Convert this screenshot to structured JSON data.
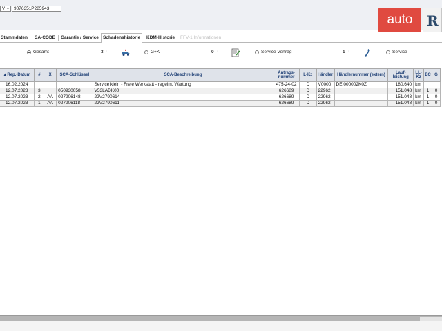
{
  "header": {
    "vin_select_value": "V",
    "vin_value": "9076351P285943",
    "logo_text": "auto",
    "logo2_text": "R"
  },
  "tabs": [
    {
      "label": "Stammdaten"
    },
    {
      "label": "SA-CODE"
    },
    {
      "label": "Garantie / Service"
    },
    {
      "label": "Schadenshistorie"
    },
    {
      "label": "KDM-Historie"
    },
    {
      "label": "FFV-1 Informationen"
    }
  ],
  "filters": {
    "gesamt_label": "Gesamt",
    "gk_count": "3",
    "gk_label": "G+K",
    "vertrag_count": "0",
    "vertrag_label": "Service Vertrag",
    "service_count": "1",
    "service_label": "Service"
  },
  "table": {
    "columns": [
      "Rep.-Datum",
      "#",
      "X",
      "SCA-Schlüssel",
      "SCA-Beschreibung",
      "Antrags-nummer",
      "L-Kz",
      "Händler",
      "Händlernummer (extern)",
      "Lauf-leistung",
      "LL-Kz",
      "EC",
      "G"
    ],
    "rows": [
      [
        "16.02.2024",
        "",
        "",
        "",
        "Service klein - Freie Werkstatt - regelm. Wartung",
        "475-24-02",
        "D",
        "V0000",
        "DEI000002K0Z",
        "180.640",
        "km",
        "",
        ""
      ],
      [
        "12.07.2023",
        "3",
        "",
        "050930058",
        "V53LADK00",
        "626689",
        "D",
        "22962",
        "",
        "151.048",
        "km",
        "1",
        "0"
      ],
      [
        "12.07.2023",
        "2",
        "AA",
        "027906148",
        "22V2790614",
        "626689",
        "D",
        "22962",
        "",
        "151.048",
        "km",
        "1",
        "0"
      ],
      [
        "12.07.2023",
        "1",
        "AA",
        "027906118",
        "22V2790611",
        "626689",
        "D",
        "22962",
        "",
        "151.048",
        "km",
        "1",
        "0"
      ]
    ]
  }
}
